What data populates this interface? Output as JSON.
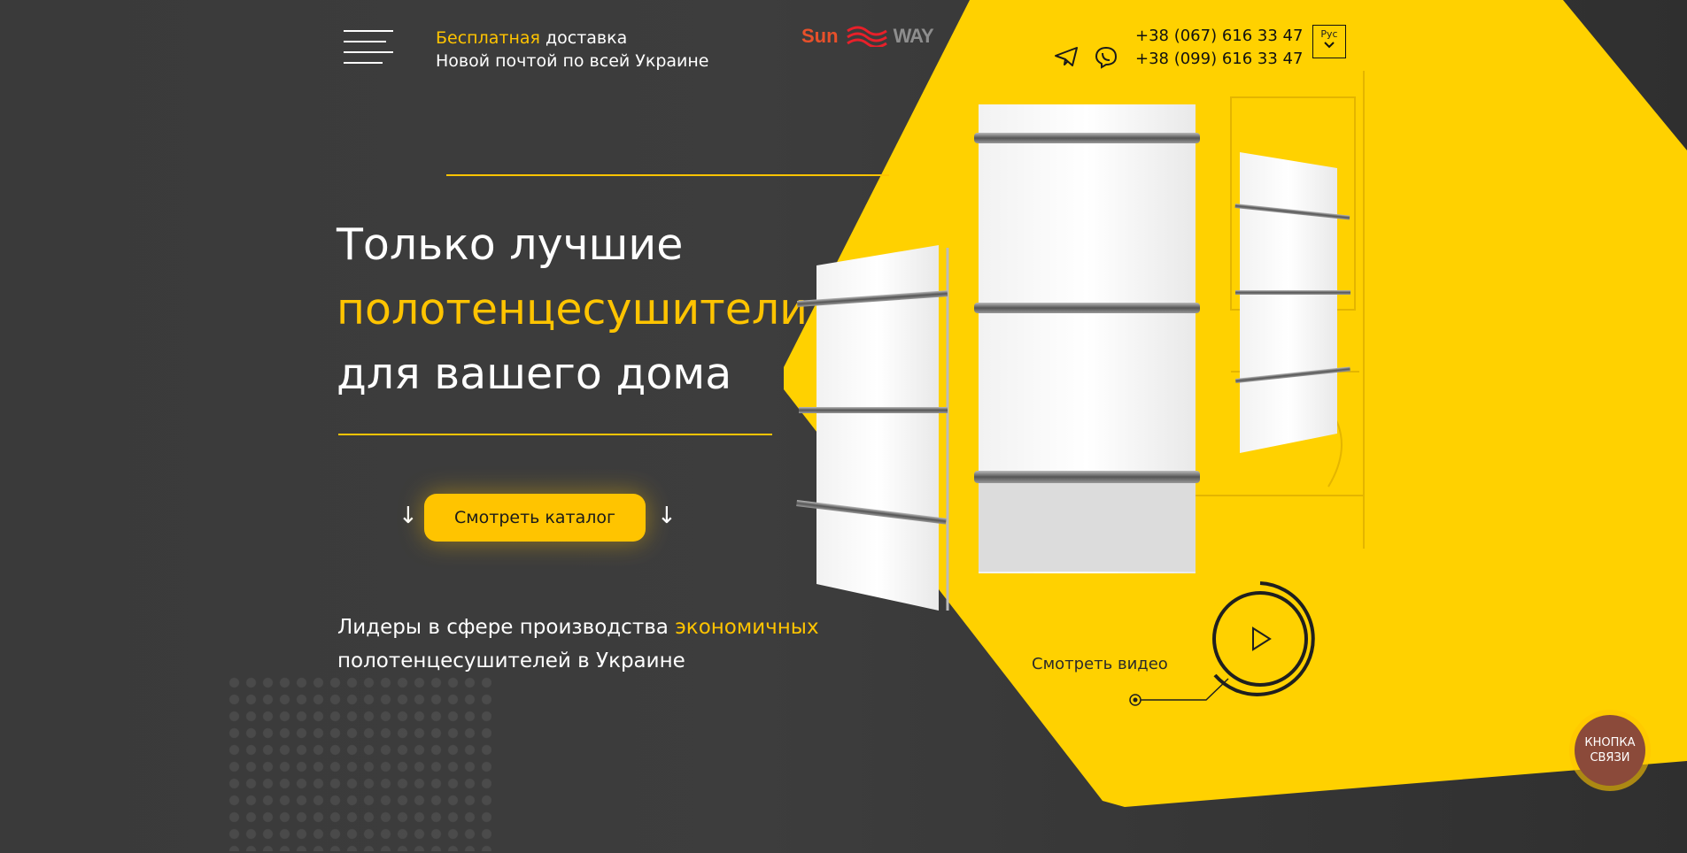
{
  "header": {
    "delivery_highlight": "Бесплатная",
    "delivery_rest": " доставка",
    "delivery_line2": "Новой почтой по всей Украине",
    "logo_sun": "Sun",
    "logo_way": "WAY",
    "phone1": "+38 (067) 616 33 47",
    "phone2": "+38 (099) 616 33 47",
    "lang": "Рус",
    "icons": [
      "menu-icon",
      "telegram-icon",
      "viber-icon",
      "chevron-down-icon"
    ]
  },
  "hero": {
    "line1": "Только лучшие",
    "line2": "полотенцесушители",
    "line3": "для вашего дома",
    "cta": "Смотреть каталог",
    "arrow": "↓",
    "sub_part1": "Лидеры в сфере производства ",
    "sub_highlight": "экономичных",
    "sub_line2": "полотенцесушителей в Украине"
  },
  "video": {
    "label": "Смотреть видео"
  },
  "chat_button": {
    "line1": "КНОПКА",
    "line2": "СВЯЗИ"
  },
  "colors": {
    "accent": "#ffc400",
    "background": "#3a3a3a",
    "logo_red": "#e8502a"
  }
}
